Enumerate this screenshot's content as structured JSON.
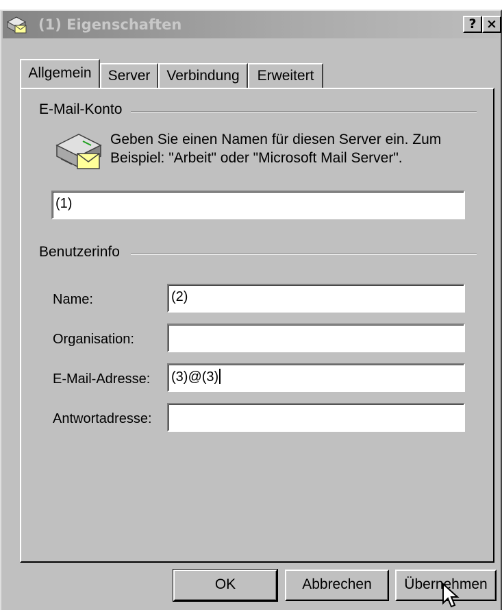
{
  "window": {
    "title": "(1) Eigenschaften",
    "help_label": "?",
    "close_label": "×"
  },
  "tabs": [
    {
      "label": "Allgemein",
      "active": true
    },
    {
      "label": "Server",
      "active": false
    },
    {
      "label": "Verbindung",
      "active": false
    },
    {
      "label": "Erweitert",
      "active": false
    }
  ],
  "mail_account": {
    "section_label": "E-Mail-Konto",
    "hint_line1": "Geben Sie einen Namen für diesen Server ein. Zum",
    "hint_line2": "Beispiel: \"Arbeit\" oder \"Microsoft Mail Server\".",
    "account_name_value": "(1)",
    "icon": "mail-server-icon"
  },
  "user_info": {
    "section_label": "Benutzerinfo",
    "fields": [
      {
        "label": "Name:",
        "value": "(2)"
      },
      {
        "label": "Organisation:",
        "value": ""
      },
      {
        "label": "E-Mail-Adresse:",
        "value": "(3)@(3)"
      },
      {
        "label": "Antwortadresse:",
        "value": ""
      }
    ]
  },
  "buttons": {
    "ok_label": "OK",
    "cancel_label": "Abbrechen",
    "apply_label": "Übernehmen"
  },
  "colors": {
    "face": "#c0c0c0",
    "titlebar_inactive": "#808080"
  }
}
